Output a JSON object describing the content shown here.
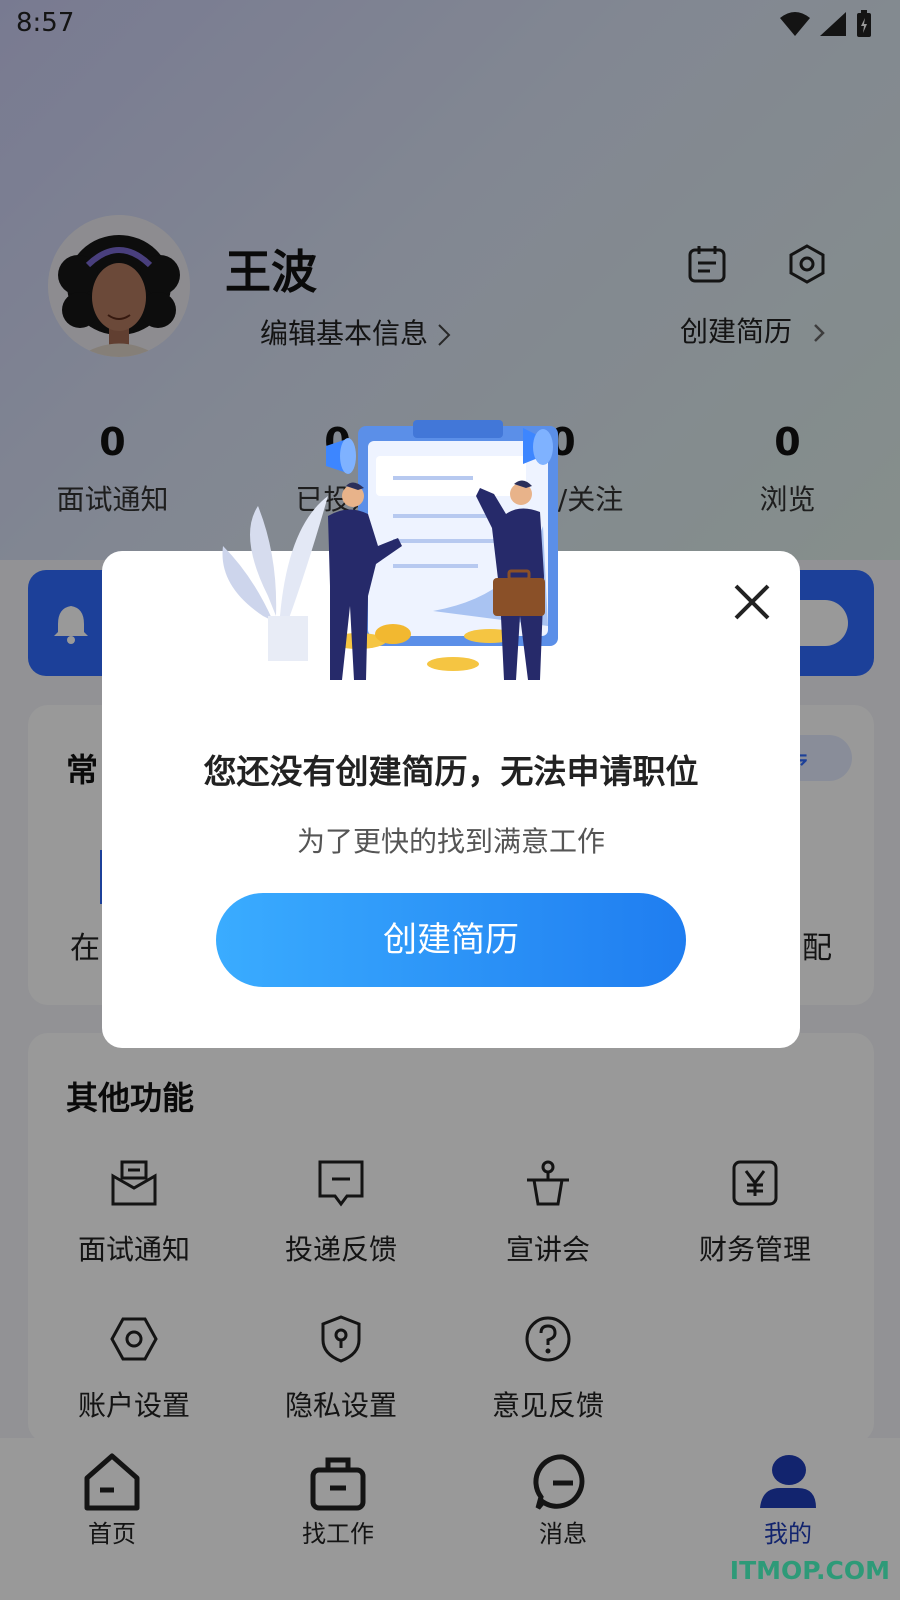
{
  "status_bar": {
    "time": "8:57"
  },
  "profile": {
    "name": "王波",
    "edit_info_label": "编辑基本信息",
    "create_resume_label": "创建简历"
  },
  "stats": [
    {
      "value": "0",
      "label": "面试通知"
    },
    {
      "value": "0",
      "label": "已投递"
    },
    {
      "value": "0",
      "label": "收藏/关注"
    },
    {
      "value": "0",
      "label": "浏览"
    }
  ],
  "common_section": {
    "title_partial": "常",
    "item_left_partial": "在",
    "item_right_partial": "配"
  },
  "other_section": {
    "title": "其他功能",
    "items": [
      {
        "label": "面试通知",
        "icon": "mailbox-icon"
      },
      {
        "label": "投递反馈",
        "icon": "message-icon"
      },
      {
        "label": "宣讲会",
        "icon": "podium-icon"
      },
      {
        "label": "财务管理",
        "icon": "yen-icon"
      },
      {
        "label": "账户设置",
        "icon": "settings-icon"
      },
      {
        "label": "隐私设置",
        "icon": "shield-icon"
      },
      {
        "label": "意见反馈",
        "icon": "question-icon"
      }
    ]
  },
  "tabbar": {
    "items": [
      {
        "label": "首页",
        "icon": "home-icon",
        "active": false
      },
      {
        "label": "找工作",
        "icon": "briefcase-icon",
        "active": false
      },
      {
        "label": "消息",
        "icon": "chat-icon",
        "active": false
      },
      {
        "label": "我的",
        "icon": "person-icon",
        "active": true
      }
    ]
  },
  "modal": {
    "title": "您还没有创建简历，无法申请职位",
    "subtitle": "为了更快的找到满意工作",
    "button_label": "创建简历"
  },
  "watermark": "ITMOP.COM",
  "colors": {
    "primary_blue": "#2f6cff",
    "button_gradient_start": "#3aacff",
    "button_gradient_end": "#1f7df0",
    "active_tab": "#1f3cb8"
  }
}
